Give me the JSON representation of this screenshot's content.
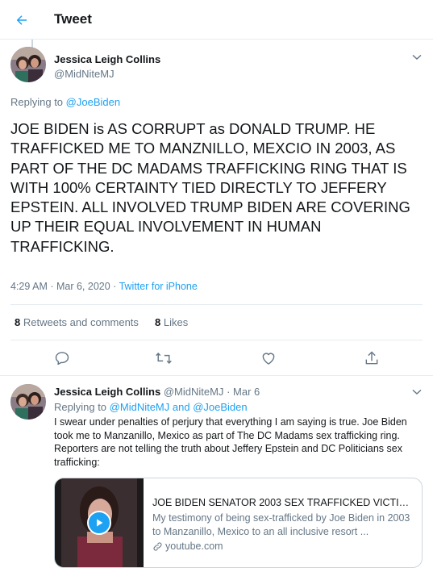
{
  "header": {
    "title": "Tweet",
    "back_icon": "arrow-left-icon"
  },
  "main_tweet": {
    "author_name": "Jessica Leigh Collins",
    "author_handle": "@MidNiteMJ",
    "replying_prefix": "Replying to",
    "replying_to": "@JoeBiden",
    "text": "JOE BIDEN is AS CORRUPT as DONALD TRUMP. HE TRAFFICKED ME TO MANZNILLO, MEXCIO IN 2003, AS PART OF THE DC MADAMS TRAFFICKING RING THAT IS WITH 100% CERTAINTY TIED DIRECTLY TO JEFFERY EPSTEIN. ALL INVOLVED TRUMP BIDEN ARE COVERING UP THEIR EQUAL INVOLVEMENT IN HUMAN TRAFFICKING.",
    "timestamp": "4:29 AM · Mar 6, 2020 · ",
    "source": "Twitter for iPhone",
    "retweets_count": "8",
    "retweets_label": "Retweets and comments",
    "likes_count": "8",
    "likes_label": "Likes"
  },
  "actions": [
    "reply-icon",
    "retweet-icon",
    "like-icon",
    "share-icon"
  ],
  "reply_tweet": {
    "author_name": "Jessica Leigh Collins",
    "author_handle": "@MidNiteMJ",
    "date": "· Mar 6",
    "replying_prefix": "Replying to",
    "replying_to_1": "@MidNiteMJ",
    "replying_and": "and",
    "replying_to_2": "@JoeBiden",
    "text": "I swear under penalties of perjury  that everything I am saying is true. Joe Biden took me to Manzanillo, Mexico as part of The DC Madams sex trafficking ring. Reporters are not telling the truth about Jeffery Epstein and DC Politicians sex trafficking:",
    "card": {
      "title": "JOE BIDEN SENATOR 2003 SEX TRAFFICKED VICTIM J...",
      "description": "My testimony of being sex-trafficked by Joe Biden in 2003 to Manzanillo, Mexico to an all inclusive resort ...",
      "domain": "youtube.com"
    }
  },
  "colors": {
    "accent": "#1da1f2",
    "muted": "#657786",
    "border": "#e6ecf0",
    "text": "#14171a"
  }
}
